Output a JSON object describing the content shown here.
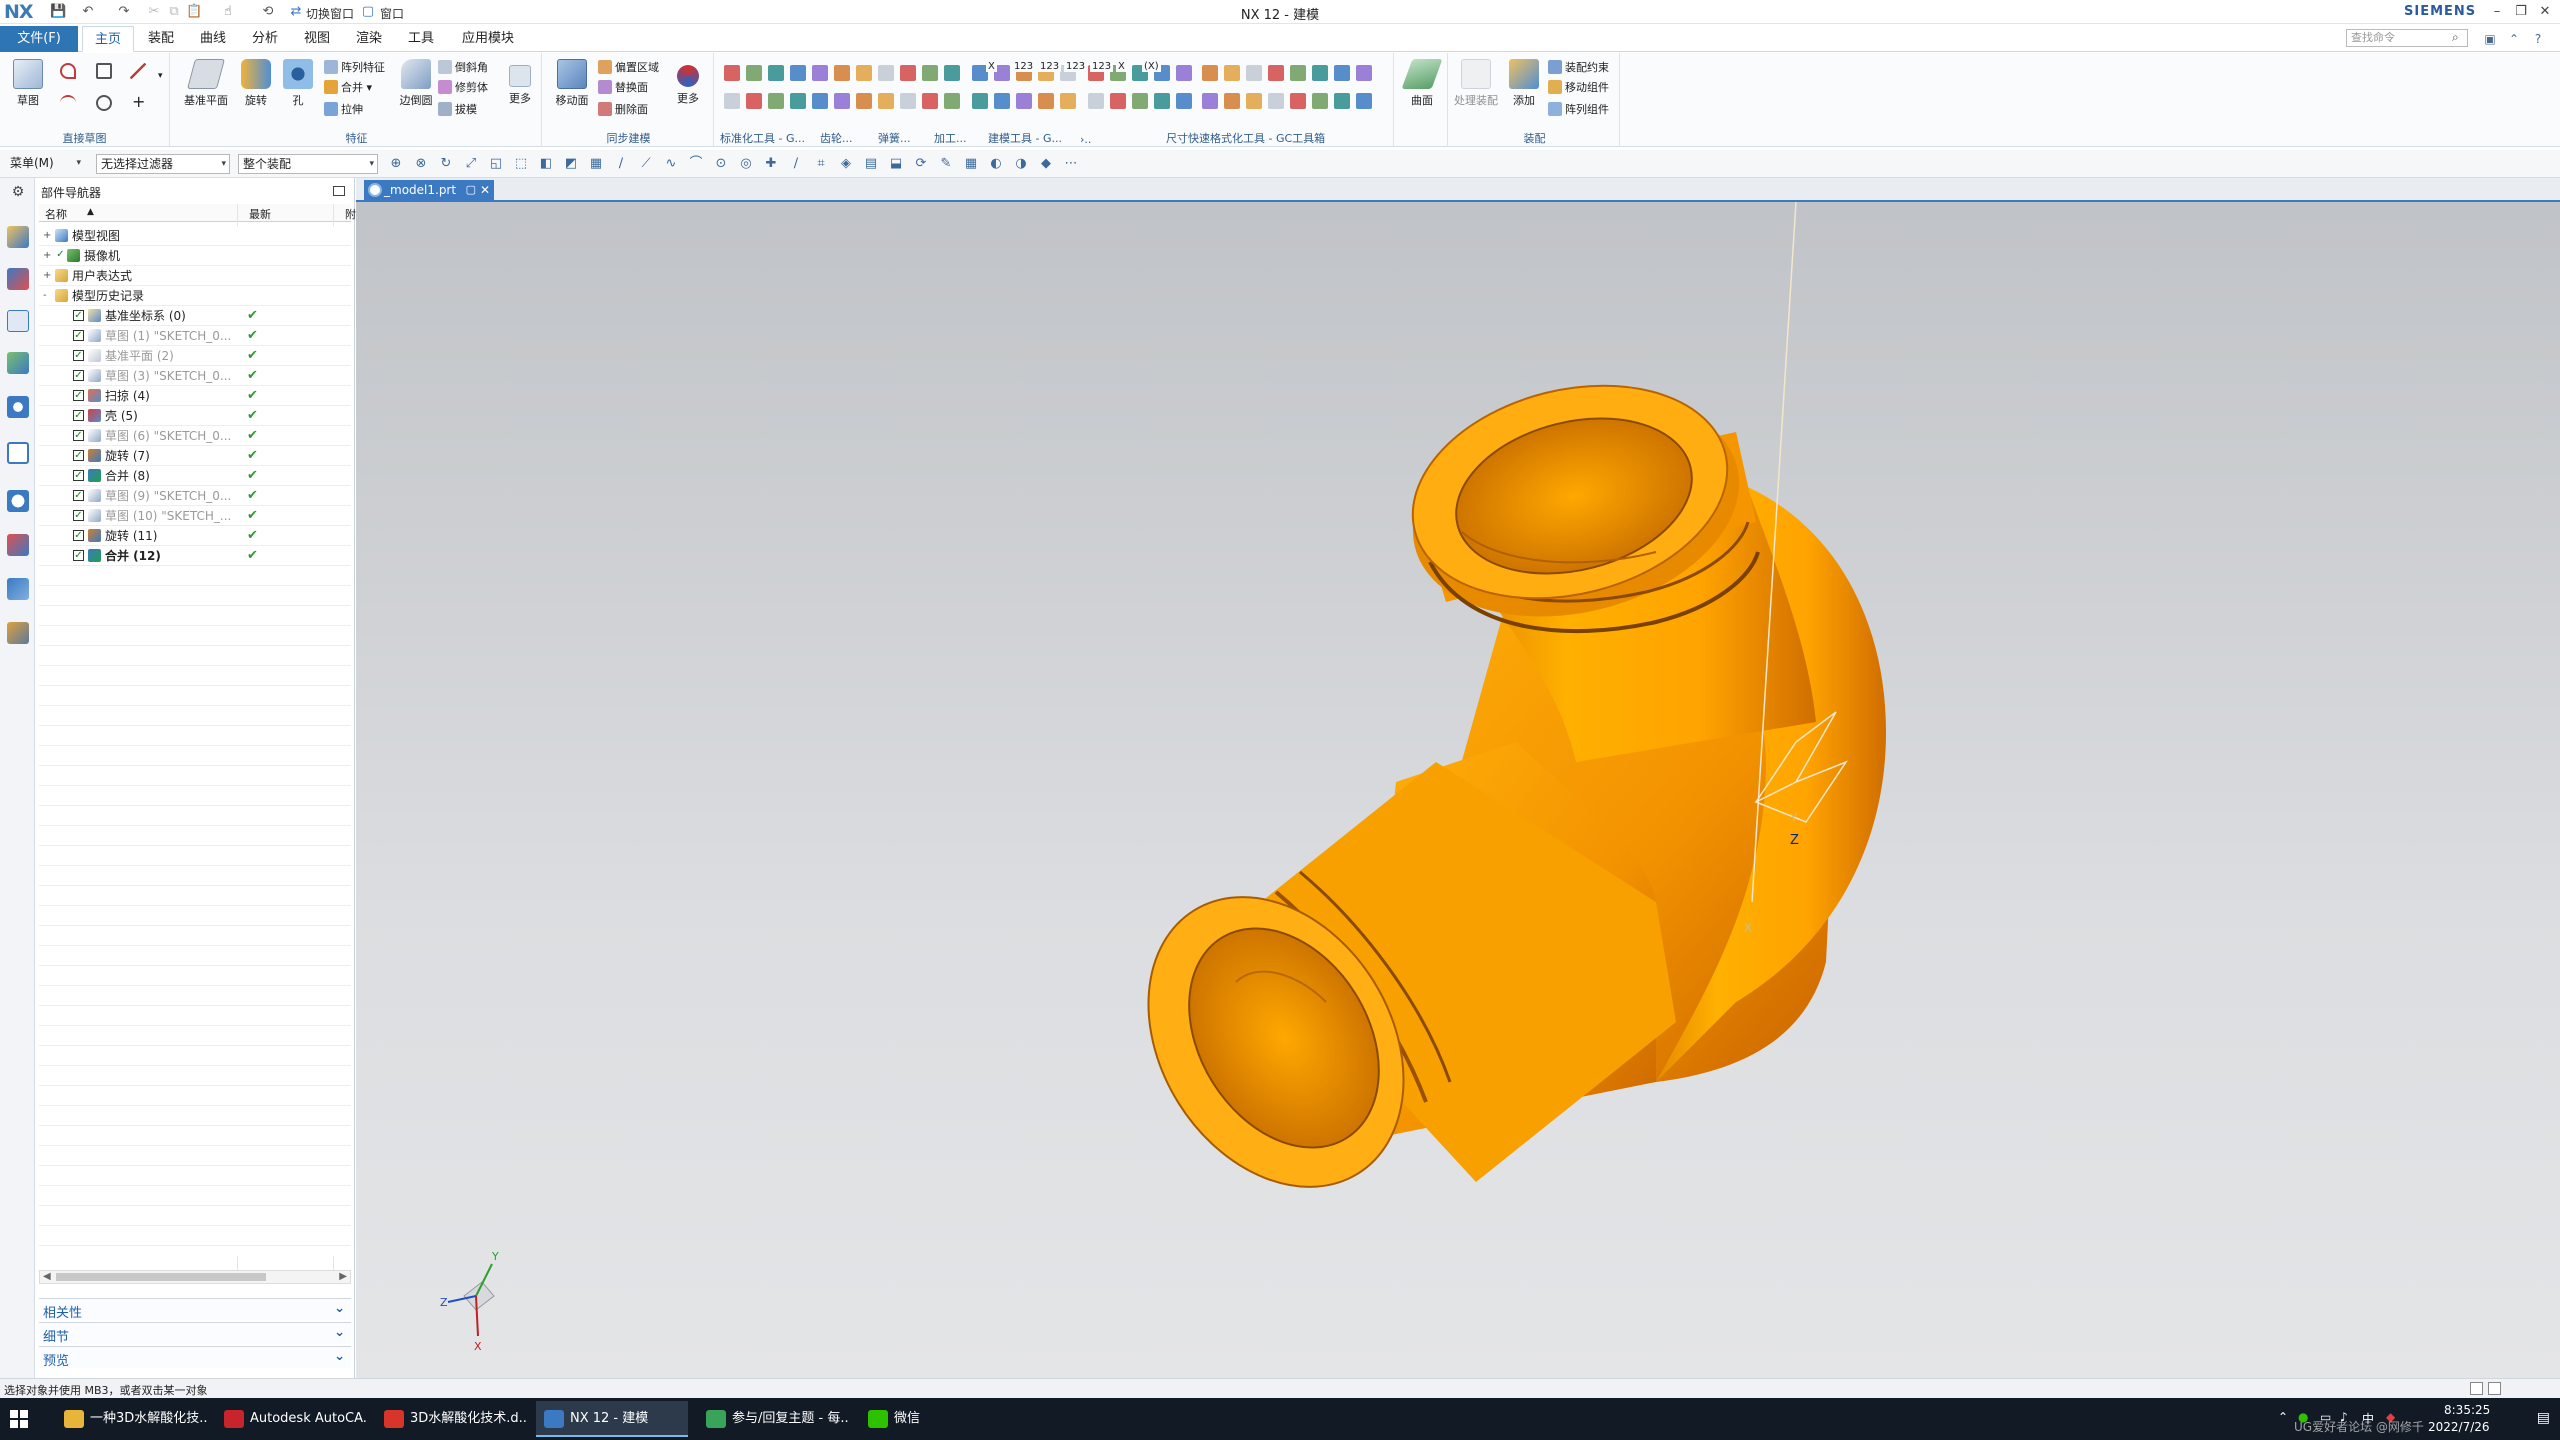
{
  "app": {
    "logo": "NX",
    "title": "NX 12 - 建模",
    "brand": "SIEMENS",
    "quick_access": {
      "switch_window": "切换窗口",
      "window_menu": "窗口"
    }
  },
  "tabs": {
    "file": "文件(F)",
    "items": [
      "主页",
      "装配",
      "曲线",
      "分析",
      "视图",
      "渲染",
      "工具",
      "应用模块"
    ],
    "active": "主页",
    "search_placeholder": "查找命令"
  },
  "ribbon": {
    "sketch": {
      "label": "草图",
      "group": "直接草图"
    },
    "feature": {
      "datum_plane": "基准平面",
      "revolve": "旋转",
      "hole": "孔",
      "pattern_feature": "阵列特征",
      "unite": "合并",
      "extrude": "拉伸",
      "edge_blend": "边倒圆",
      "chamfer": "倒斜角",
      "trim_body": "修剪体",
      "draft": "拔模",
      "more": "更多",
      "group": "特征"
    },
    "sync": {
      "move_face": "移动面",
      "offset_region": "偏置区域",
      "replace_face": "替换面",
      "delete_face": "删除面",
      "more": "更多",
      "group": "同步建模"
    },
    "groups": {
      "std": "标准化工具 - G...",
      "gear": "齿轮...",
      "spring": "弹簧...",
      "machining": "加工...",
      "modeling_tools": "建模工具 - G...",
      "more_arrow": "›..",
      "dimension": "尺寸快速格式化工具 - GC工具箱"
    },
    "surface": {
      "label": "曲面"
    },
    "assembly": {
      "ghost": "处理装配",
      "add": "添加",
      "constraint": "装配约束",
      "move_component": "移动组件",
      "pattern_component": "阵列组件",
      "group": "装配"
    },
    "dim_icons": [
      "X",
      "123",
      "123",
      "123",
      "123",
      "X",
      "(X)"
    ]
  },
  "selection_bar": {
    "menu": "菜单(M)",
    "filter": "无选择过滤器",
    "scope": "整个装配"
  },
  "navigator": {
    "title": "部件导航器",
    "columns": {
      "name": "名称",
      "latest": "最新",
      "extra": "附"
    },
    "nodes": [
      {
        "label": "模型视图",
        "level": 0,
        "icon": "model-views-icon",
        "expander": "+"
      },
      {
        "label": "摄像机",
        "level": 0,
        "icon": "camera-icon",
        "expander": "+"
      },
      {
        "label": "用户表达式",
        "level": 0,
        "icon": "folder-icon",
        "expander": "+"
      },
      {
        "label": "模型历史记录",
        "level": 0,
        "icon": "folder-icon",
        "expander": "-"
      },
      {
        "label": "基准坐标系 (0)",
        "level": 1,
        "icon": "datum-csys-icon",
        "latest": "✔",
        "style": "normal"
      },
      {
        "label": "草图 (1) \"SKETCH_0...",
        "level": 1,
        "icon": "sketch-icon",
        "latest": "✔",
        "style": "grey"
      },
      {
        "label": "基准平面 (2)",
        "level": 1,
        "icon": "datum-plane-icon",
        "latest": "✔",
        "style": "grey"
      },
      {
        "label": "草图 (3) \"SKETCH_0...",
        "level": 1,
        "icon": "sketch-icon",
        "latest": "✔",
        "style": "grey"
      },
      {
        "label": "扫掠 (4)",
        "level": 1,
        "icon": "sweep-icon",
        "latest": "✔",
        "style": "normal"
      },
      {
        "label": "壳 (5)",
        "level": 1,
        "icon": "shell-icon",
        "latest": "✔",
        "style": "normal"
      },
      {
        "label": "草图 (6) \"SKETCH_0...",
        "level": 1,
        "icon": "sketch-icon",
        "latest": "✔",
        "style": "grey"
      },
      {
        "label": "旋转 (7)",
        "level": 1,
        "icon": "revolve-icon",
        "latest": "✔",
        "style": "normal"
      },
      {
        "label": "合并 (8)",
        "level": 1,
        "icon": "unite-icon",
        "latest": "✔",
        "style": "normal"
      },
      {
        "label": "草图 (9) \"SKETCH_0...",
        "level": 1,
        "icon": "sketch-icon",
        "latest": "✔",
        "style": "grey"
      },
      {
        "label": "草图 (10) \"SKETCH_...",
        "level": 1,
        "icon": "sketch-icon",
        "latest": "✔",
        "style": "grey"
      },
      {
        "label": "旋转 (11)",
        "level": 1,
        "icon": "revolve-icon",
        "latest": "✔",
        "style": "normal"
      },
      {
        "label": "合并 (12)",
        "level": 1,
        "icon": "unite-icon",
        "latest": "✔",
        "style": "bold"
      }
    ],
    "panels": [
      "相关性",
      "细节",
      "预览"
    ]
  },
  "document": {
    "tab": "_model1.prt"
  },
  "viewport": {
    "csys_labels": {
      "x": "X",
      "y": "Y",
      "z": "Z"
    },
    "triad_labels": {
      "x": "X",
      "y": "Y",
      "z": "Z"
    }
  },
  "status": {
    "text": "选择对象并使用 MB3，或者双击某一对象"
  },
  "taskbar": {
    "tasks": [
      {
        "label": "一种3D水解酸化技...",
        "icon": "folder-icon",
        "color": "#e8b43a"
      },
      {
        "label": "Autodesk AutoCA...",
        "icon": "autocad-icon",
        "color": "#c8242c"
      },
      {
        "label": "3D水解酸化技术.d...",
        "icon": "wps-icon",
        "color": "#d8352a"
      },
      {
        "label": "NX 12 - 建模",
        "icon": "nx-icon",
        "color": "#3b79c3"
      },
      {
        "label": "参与/回复主题 - 每...",
        "icon": "browser-icon",
        "color": "#3aa35a"
      },
      {
        "label": "微信",
        "icon": "wechat-icon",
        "color": "#2dc100"
      }
    ],
    "time": "8:35:25",
    "date": "2022/7/26",
    "watermark": "UG爱好者论坛 @网修千"
  },
  "colors": {
    "accent": "#2e75b6",
    "model": "#ffa500",
    "bg_top": "#c0c3c7",
    "bg_bottom": "#e4e5e7"
  }
}
